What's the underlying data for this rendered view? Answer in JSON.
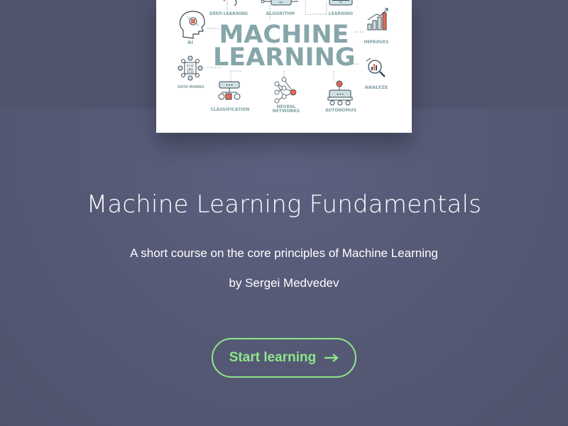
{
  "cover": {
    "heading_line1": "MACHINE",
    "heading_line2": "LEARNING",
    "labels": {
      "deep_learning": "DEEP LEARNING",
      "algorithm": "ALGORITHM",
      "learning": "LEARNING",
      "ai": "AI",
      "improves": "IMPROVES",
      "data_mining": "DATA MINING",
      "analyze": "ANALYZE",
      "classification": "CLASSIFICATION",
      "neural_networks_1": "NEURAL",
      "neural_networks_2": "NETWORKS",
      "autonomus": "AUTONOMUS"
    },
    "colors": {
      "teal": "#86a6aa",
      "accent": "#e8674a",
      "ink": "#3b4a57"
    }
  },
  "course": {
    "title": "Machine Learning Fundamentals",
    "subtitle": "A short course on the core principles of Machine Learning",
    "author": "by Sergei Medvedev"
  },
  "cta": {
    "label": "Start learning",
    "icon": "arrow-right-icon",
    "color": "#8ee68b"
  }
}
